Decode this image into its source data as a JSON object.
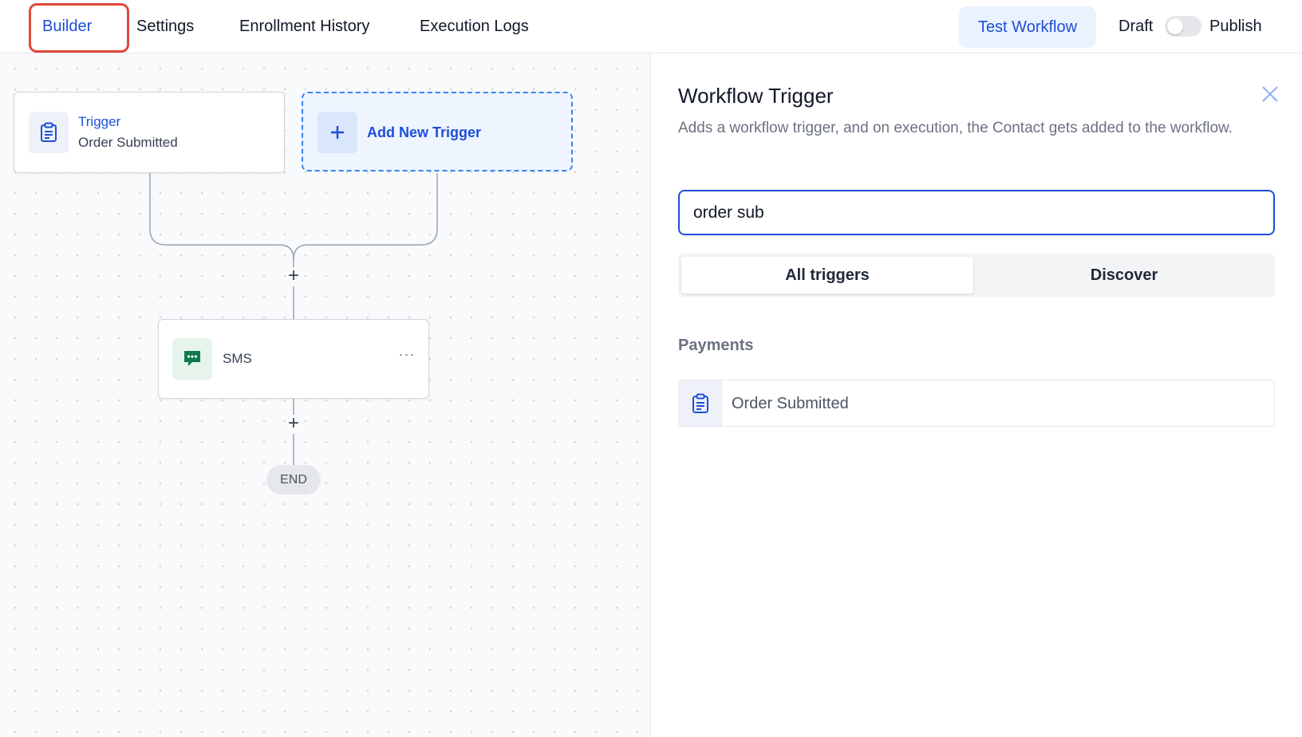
{
  "nav": {
    "tabs": [
      {
        "label": "Builder",
        "active": true
      },
      {
        "label": "Settings",
        "active": false
      },
      {
        "label": "Enrollment History",
        "active": false
      },
      {
        "label": "Execution Logs",
        "active": false
      }
    ],
    "test_workflow_label": "Test Workflow",
    "draft_label": "Draft",
    "publish_label": "Publish",
    "publish_toggle_on": false
  },
  "canvas": {
    "trigger_node": {
      "title": "Trigger",
      "subtitle": "Order Submitted",
      "icon": "clipboard-icon"
    },
    "add_trigger": {
      "label": "Add New Trigger",
      "icon": "plus-icon"
    },
    "add_step_symbol": "+",
    "action_node": {
      "label": "SMS",
      "icon": "chat-icon",
      "menu_symbol": "···"
    },
    "end_label": "END"
  },
  "panel": {
    "title": "Workflow Trigger",
    "description": "Adds a workflow trigger, and on execution, the Contact gets added to the workflow.",
    "search": {
      "value": "order sub",
      "placeholder": ""
    },
    "tabs": [
      {
        "label": "All triggers",
        "active": true
      },
      {
        "label": "Discover",
        "active": false
      }
    ],
    "section": "Payments",
    "results": [
      {
        "label": "Order Submitted",
        "icon": "clipboard-icon"
      }
    ]
  },
  "colors": {
    "accent": "#1d4ed8",
    "highlight_border": "#e0483b",
    "sms_green": "#0f7a4a"
  }
}
